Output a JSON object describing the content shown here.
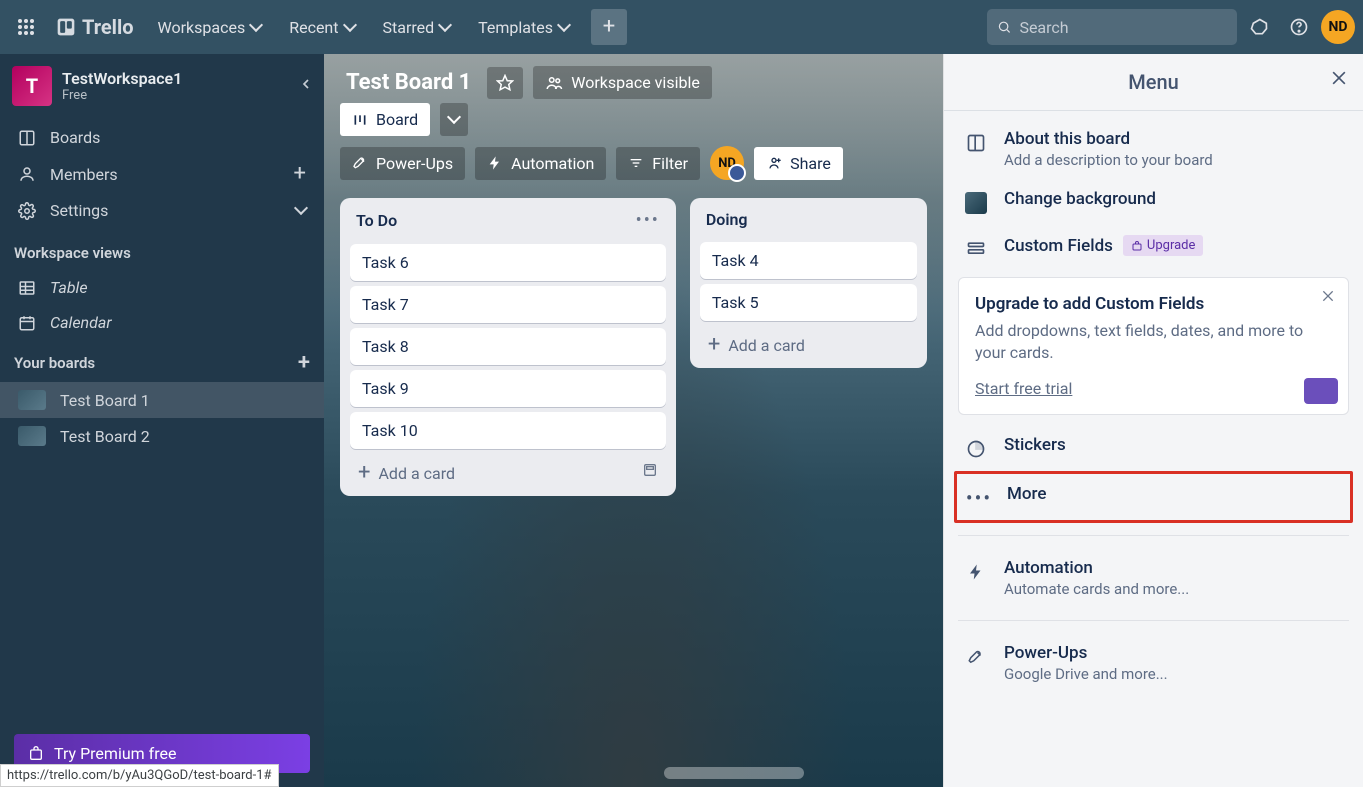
{
  "topnav": {
    "brand": "Trello",
    "workspaces": "Workspaces",
    "recent": "Recent",
    "starred": "Starred",
    "templates": "Templates",
    "search_placeholder": "Search",
    "avatar": "ND"
  },
  "sidebar": {
    "workspace_initial": "T",
    "workspace_name": "TestWorkspace1",
    "workspace_plan": "Free",
    "boards": "Boards",
    "members": "Members",
    "settings": "Settings",
    "views_head": "Workspace views",
    "table": "Table",
    "calendar": "Calendar",
    "your_boards_head": "Your boards",
    "board1": "Test Board 1",
    "board2": "Test Board 2",
    "premium": "Try Premium free"
  },
  "board": {
    "title": "Test Board 1",
    "visibility": "Workspace visible",
    "view_label": "Board",
    "powerups": "Power-Ups",
    "automation": "Automation",
    "filter": "Filter",
    "share": "Share",
    "member_avatar": "ND"
  },
  "lists": [
    {
      "title": "To Do",
      "cards": [
        "Task 6",
        "Task 7",
        "Task 8",
        "Task 9",
        "Task 10"
      ],
      "add": "Add a card"
    },
    {
      "title": "Doing",
      "cards": [
        "Task 4",
        "Task 5"
      ],
      "add": "Add a card"
    }
  ],
  "menu": {
    "title": "Menu",
    "about_title": "About this board",
    "about_sub": "Add a description to your board",
    "change_bg": "Change background",
    "custom_fields": "Custom Fields",
    "upgrade_badge": "Upgrade",
    "promo_title": "Upgrade to add Custom Fields",
    "promo_text": "Add dropdowns, text fields, dates, and more to your cards.",
    "promo_link": "Start free trial",
    "stickers": "Stickers",
    "more": "More",
    "automation_title": "Automation",
    "automation_sub": "Automate cards and more...",
    "powerups_title": "Power-Ups",
    "powerups_sub": "Google Drive and more..."
  },
  "status_url": "https://trello.com/b/yAu3QGoD/test-board-1#"
}
